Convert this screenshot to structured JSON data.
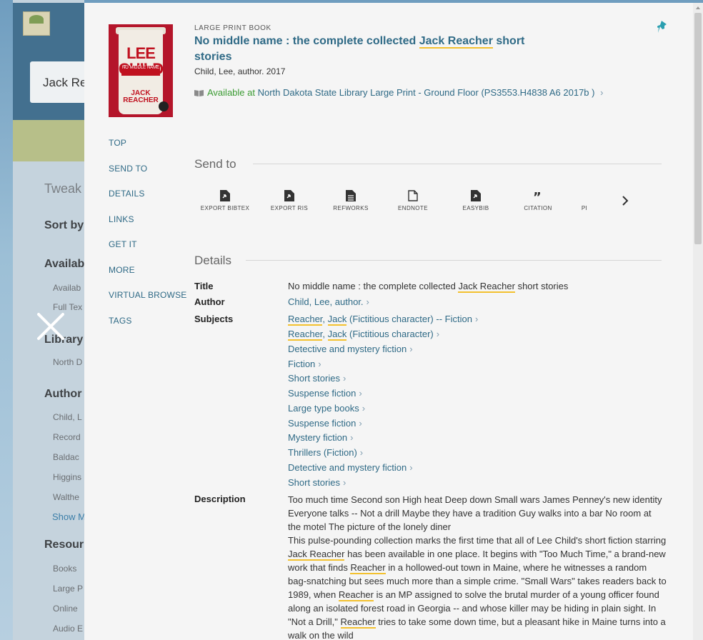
{
  "background": {
    "search_value": "Jack Re",
    "tweak_label": "Tweak",
    "sort_label": "Sort by",
    "availability_label": "Availab",
    "availability_items": [
      "Availab",
      "Full Tex"
    ],
    "library_label": "Library",
    "library_items": [
      "North D"
    ],
    "author_label": "Author",
    "author_items": [
      "Child, L",
      "Record",
      "Baldac",
      "Higgins",
      "Walthe"
    ],
    "show_more": "Show M",
    "resource_label": "Resour",
    "resource_items": [
      "Books",
      "Large P",
      "Online",
      "Audio E"
    ]
  },
  "record": {
    "type": "LARGE PRINT BOOK",
    "title_before": "No middle name : the complete collected ",
    "title_highlight": "Jack Reacher",
    "title_after": " short stories",
    "author_line": "Child, Lee, author. 2017",
    "available_text": "Available at",
    "location_text": "North Dakota State Library  Large Print - Ground Floor (PS3553.H4838 A6 2017b )",
    "cover": {
      "author": "LEE CHILD",
      "title": "NO MIDDLE NAME",
      "series": "JACK REACHER"
    }
  },
  "nav": [
    "TOP",
    "SEND TO",
    "DETAILS",
    "LINKS",
    "GET IT",
    "MORE",
    "VIRTUAL BROWSE",
    "TAGS"
  ],
  "send_to": {
    "heading": "Send to",
    "items": [
      "EXPORT BIBTEX",
      "EXPORT RIS",
      "REFWORKS",
      "ENDNOTE",
      "EASYBIB",
      "CITATION",
      "PI"
    ]
  },
  "details": {
    "heading": "Details",
    "title_label": "Title",
    "title_before": "No middle name : the complete collected ",
    "title_highlight": "Jack Reacher",
    "title_after": " short stories",
    "author_label": "Author",
    "author_value": "Child, Lee, author.",
    "subjects_label": "Subjects",
    "subjects": [
      "Detective and mystery fiction",
      "Fiction",
      "Short stories",
      "Suspense fiction",
      "Large type books",
      "Suspense fiction",
      "Mystery fiction",
      "Thrillers (Fiction)",
      "Detective and mystery fiction",
      "Short stories"
    ],
    "subject_reacher_1_tail": " (Fictitious character) -- Fiction",
    "subject_reacher_2_tail": " (Fictitious character)",
    "reacher": "Reacher",
    "jack": "Jack",
    "description_label": "Description",
    "description_p1": "Too much time Second son High heat Deep down Small wars James Penney's new identity Everyone talks -- Not a drill Maybe they have a tradition Guy walks into a bar No room at the motel The picture of the lonely diner",
    "d2_a": "This pulse-pounding collection marks the first time that all of Lee Child's short fiction starring ",
    "d2_b": " has been available in one place. It begins with \"Too Much Time,\" a brand-new work that finds ",
    "d2_c": " in a hollowed-out town in Maine, where he witnesses a random bag-snatching but sees much more than a simple crime. \"Small Wars\" takes readers back to 1989, when ",
    "d2_d": " is an MP assigned to solve the brutal murder of a young officer found along an isolated forest road in Georgia -- and whose killer may be hiding in plain sight. In \"Not a Drill,\" ",
    "d2_e": " tries to take some down time, but a pleasant hike in Maine turns into a walk on the wild",
    "jack_reacher": "Jack Reacher"
  }
}
